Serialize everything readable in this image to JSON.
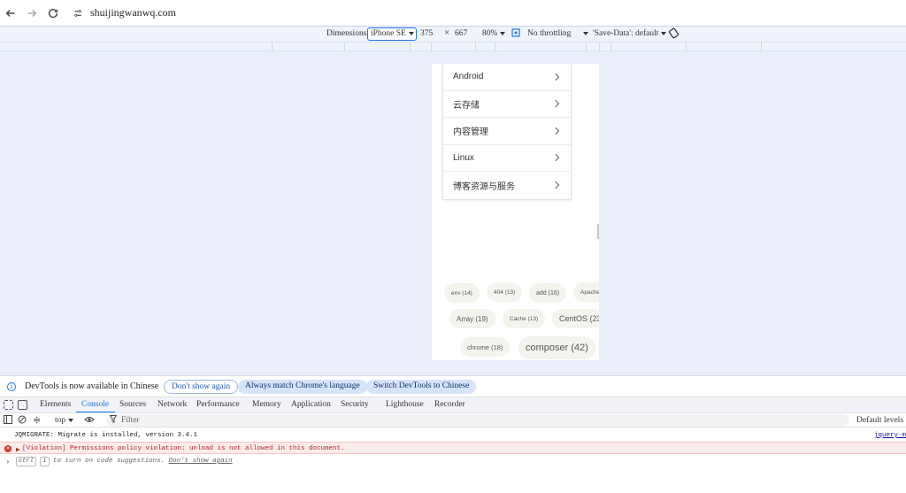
{
  "address_bar": {
    "url": "shuijingwanwq.com"
  },
  "device_toolbar": {
    "dimensions_label": "Dimensions:",
    "device": "iPhone SE",
    "width": "375",
    "times": "×",
    "height": "667",
    "zoom": "80%",
    "throttling": "No throttling",
    "save_data": "'Save-Data': default"
  },
  "page": {
    "menu_items": [
      "Android",
      "云存储",
      "内容管理",
      "Linux",
      "博客资源与服务"
    ],
    "tags": [
      {
        "label": "env (14)"
      },
      {
        "label": "404 (13)"
      },
      {
        "label": "add (16)"
      },
      {
        "label": "Apache"
      },
      {
        "label": "Array (19)"
      },
      {
        "label": "Cache (13)"
      },
      {
        "label": "CentOS (23"
      },
      {
        "label": "chrome (18)"
      },
      {
        "label": "composer (42)"
      }
    ]
  },
  "infobar": {
    "message": "DevTools is now available in Chinese",
    "btn_dont_show": "Don't show again",
    "btn_match": "Always match Chrome's language",
    "btn_switch": "Switch DevTools to Chinese"
  },
  "devtools_tabs": [
    "Elements",
    "Console",
    "Sources",
    "Network",
    "Performance",
    "Memory",
    "Application",
    "Security",
    "Lighthouse",
    "Recorder"
  ],
  "console_toolbar": {
    "context": "top",
    "filter_placeholder": "Filter",
    "levels": "Default levels"
  },
  "console": {
    "log1": "JQMIGRATE: Migrate is installed, version 3.4.1",
    "log1_source": "jquery-m",
    "error1": "[Violation] Permissions policy violation: unload is not allowed in this document.",
    "hint_key1": "ctrl",
    "hint_key2": "i",
    "hint_text": "to turn on code suggestions.",
    "hint_link": "Don't show again"
  },
  "colors": {
    "accent": "#1a73e8",
    "viewport_bg": "#e9eef8",
    "error_bg": "#fcebeb"
  }
}
